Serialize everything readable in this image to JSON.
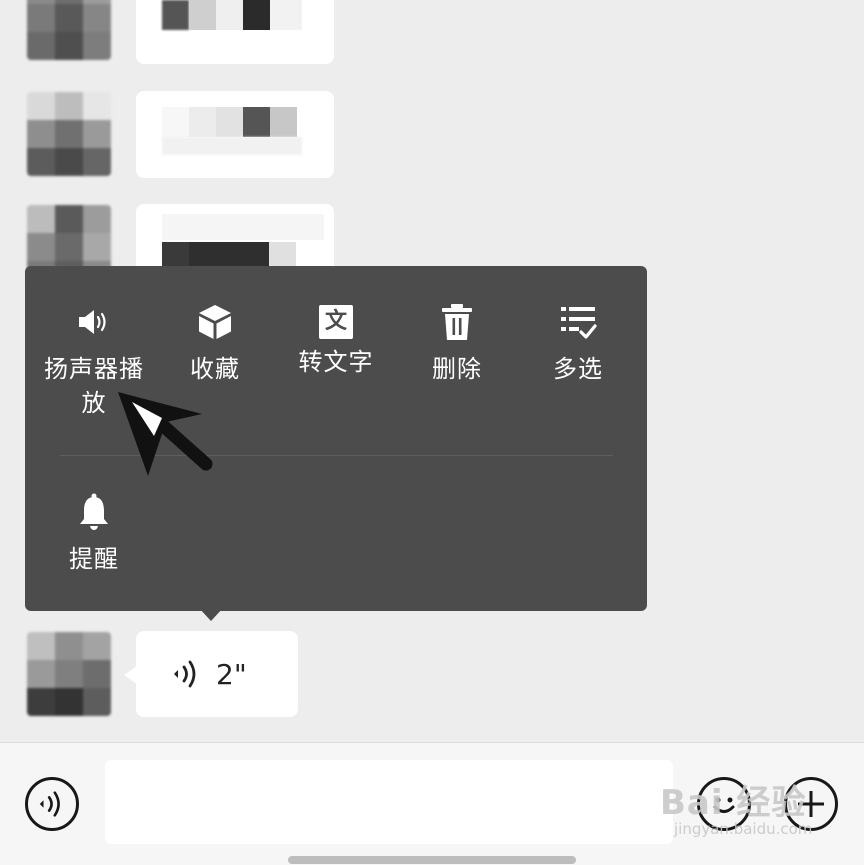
{
  "context_menu": {
    "items": [
      {
        "label": "扬声器播放",
        "icon": "speaker-icon"
      },
      {
        "label": "收藏",
        "icon": "cube-icon"
      },
      {
        "label": "转文字",
        "icon": "text-convert-icon"
      },
      {
        "label": "删除",
        "icon": "trash-icon"
      },
      {
        "label": "多选",
        "icon": "multi-select-icon"
      },
      {
        "label": "提醒",
        "icon": "bell-icon"
      }
    ],
    "text_icon_glyph": "文"
  },
  "voice_message": {
    "duration": "2\"",
    "icon": "voice-wave-icon"
  },
  "input_bar": {
    "voice_toggle_icon": "voice-wave-icon",
    "input_value": "",
    "emoji_icon": "smile-icon",
    "plus_icon": "plus-icon"
  },
  "watermark": {
    "brand": "Bai 经验",
    "url": "jingyan.baidu.com"
  },
  "annotation": {
    "arrow": "arrow-pointer-icon",
    "color": "#111111"
  },
  "colors": {
    "page_bg": "#ededed",
    "menu_bg": "#4c4c4c",
    "bubble_bg": "#ffffff"
  }
}
